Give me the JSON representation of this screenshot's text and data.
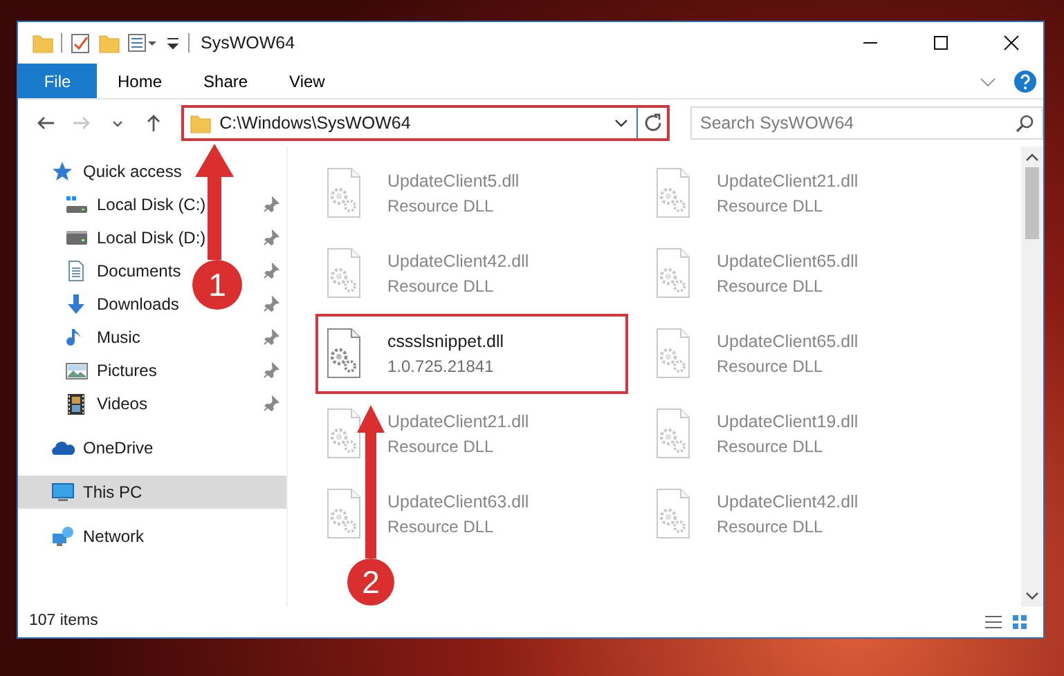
{
  "window": {
    "title": "SysWOW64"
  },
  "ribbon_tabs": [
    {
      "label": "File",
      "kind": "file",
      "selected": false
    },
    {
      "label": "Home",
      "kind": "tab",
      "selected": false
    },
    {
      "label": "Share",
      "kind": "tab",
      "selected": false
    },
    {
      "label": "View",
      "kind": "tab",
      "selected": false
    }
  ],
  "address_bar": {
    "path": "C:\\Windows\\SysWOW64",
    "highlighted": true
  },
  "search": {
    "placeholder": "Search SysWOW64"
  },
  "sidebar": {
    "items": [
      {
        "label": "Quick access",
        "kind": "star",
        "selected": false,
        "children": [
          {
            "label": "Local Disk (C:)",
            "kind": "system-drive",
            "pinned": true,
            "selected": false
          },
          {
            "label": "Local Disk (D:)",
            "kind": "drive",
            "pinned": true,
            "selected": false
          },
          {
            "label": "Documents",
            "kind": "documents",
            "pinned": true,
            "selected": false
          },
          {
            "label": "Downloads",
            "kind": "downloads",
            "pinned": true,
            "selected": false
          },
          {
            "label": "Music",
            "kind": "music",
            "pinned": true,
            "selected": false
          },
          {
            "label": "Pictures",
            "kind": "pictures",
            "pinned": true,
            "selected": false
          },
          {
            "label": "Videos",
            "kind": "videos",
            "pinned": true,
            "selected": false
          }
        ]
      },
      {
        "label": "OneDrive",
        "kind": "cloud",
        "selected": false
      },
      {
        "label": "This PC",
        "kind": "computer",
        "selected": true
      },
      {
        "label": "Network",
        "kind": "network",
        "selected": false
      }
    ]
  },
  "files": [
    {
      "name": "UpdateClient5.dll",
      "description": "Resource DLL",
      "blurred": true,
      "highlighted": false
    },
    {
      "name": "UpdateClient21.dll",
      "description": "Resource DLL",
      "blurred": true,
      "highlighted": false
    },
    {
      "name": "UpdateClient42.dll",
      "description": "Resource DLL",
      "blurred": true,
      "highlighted": false
    },
    {
      "name": "UpdateClient65.dll",
      "description": "Resource DLL",
      "blurred": true,
      "highlighted": false
    },
    {
      "name": "cssslsnippet.dll",
      "description": "1.0.725.21841",
      "blurred": false,
      "highlighted": true
    },
    {
      "name": "UpdateClient65.dll",
      "description": "Resource DLL",
      "blurred": true,
      "highlighted": false
    },
    {
      "name": "UpdateClient21.dll",
      "description": "Resource DLL",
      "blurred": true,
      "highlighted": false
    },
    {
      "name": "UpdateClient19.dll",
      "description": "Resource DLL",
      "blurred": true,
      "highlighted": false
    },
    {
      "name": "UpdateClient63.dll",
      "description": "Resource DLL",
      "blurred": true,
      "highlighted": false
    },
    {
      "name": "UpdateClient42.dll",
      "description": "Resource DLL",
      "blurred": true,
      "highlighted": false
    }
  ],
  "status_bar": {
    "item_count": "107 items"
  },
  "callouts": [
    {
      "number": "1"
    },
    {
      "number": "2"
    }
  ]
}
